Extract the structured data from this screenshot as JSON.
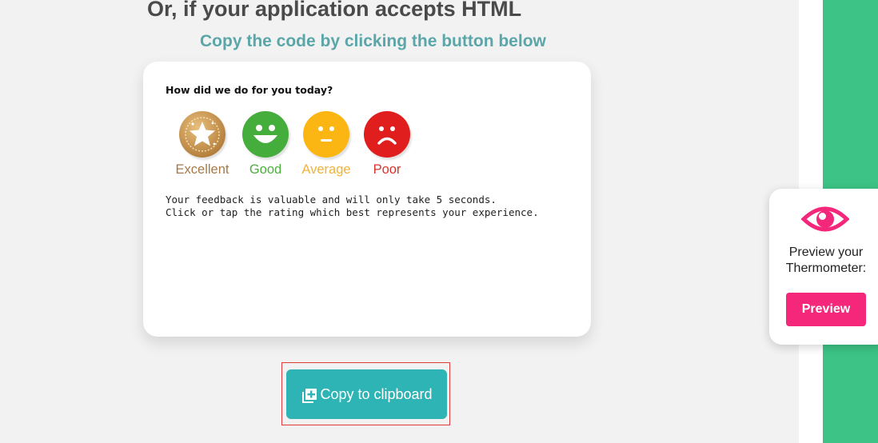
{
  "heading": "Or, if your application accepts HTML",
  "subheading": "Copy the code by clicking the button below",
  "card": {
    "question": "How did we do for you today?",
    "ratings": [
      {
        "label": "Excellent",
        "icon": "star-medal-icon",
        "color": "#a57a4a"
      },
      {
        "label": "Good",
        "icon": "smile-face-icon",
        "color": "#4caf3c"
      },
      {
        "label": "Average",
        "icon": "neutral-face-icon",
        "color": "#f0b23a"
      },
      {
        "label": "Poor",
        "icon": "sad-face-icon",
        "color": "#d9342b"
      }
    ],
    "note_line1": "Your feedback is valuable and will only take 5 seconds.",
    "note_line2": "Click or tap the rating which best represents your experience."
  },
  "copy_button": {
    "label": "Copy to clipboard",
    "icon": "copy-plus-icon"
  },
  "preview": {
    "line1": "Preview your",
    "line2": "Thermometer:",
    "button": "Preview",
    "icon": "eye-icon",
    "accent": "#f5277a"
  },
  "colors": {
    "background": "#f2f2f2",
    "green_strip": "#3cc385",
    "subheading": "#5aa6a8",
    "copy_button": "#2eb4b4"
  }
}
